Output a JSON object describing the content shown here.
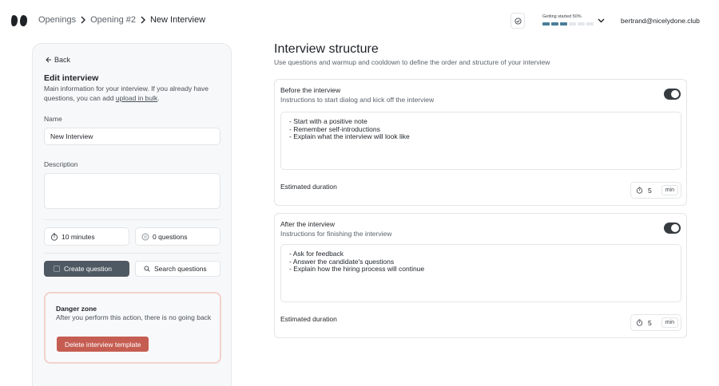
{
  "breadcrumb": {
    "items": [
      "Openings",
      "Opening #2"
    ],
    "current": "New Interview"
  },
  "header": {
    "progress_label": "Getting started 50%",
    "progress_percent": 50,
    "progress_segments_total": 6,
    "progress_segments_done": 3,
    "user_email": "bertrand@nicelydone.club"
  },
  "sidebar": {
    "back_label": "Back",
    "title": "Edit interview",
    "description_prefix": "Main information for your interview. If you already have questions, you can add",
    "upload_link": "upload in bulk",
    "description_suffix": ".",
    "name_label": "Name",
    "name_value": "New Interview",
    "description_label": "Description",
    "description_value": "",
    "duration_stat": "10 minutes",
    "questions_stat": "0 questions",
    "create_button": "Create question",
    "search_button": "Search questions",
    "danger": {
      "title": "Danger zone",
      "description": "After you perform this action, there is no going back",
      "button": "Delete interview template"
    }
  },
  "main": {
    "title": "Interview structure",
    "subtitle": "Use questions and warmup and cooldown to define the order and structure of your interview",
    "sections": [
      {
        "title": "Before the interview",
        "subtitle": "Instructions to start dialog and kick off the interview",
        "enabled": true,
        "lines": [
          "- Start with a positive note",
          "- Remember self-introductions",
          "- Explain what the interview will look like"
        ],
        "duration_label": "Estimated duration",
        "duration_value": "5",
        "duration_unit": "min"
      },
      {
        "title": "After the interview",
        "subtitle": "Instructions for finishing the interview",
        "enabled": true,
        "lines": [
          "- Ask for feedback",
          "- Answer the candidate's questions",
          "- Explain how the hiring process will continue"
        ],
        "duration_label": "Estimated duration",
        "duration_value": "5",
        "duration_unit": "min"
      }
    ]
  },
  "icons": {
    "logo": "logo-icon",
    "breadcrumb_separator": "chevron-right-icon",
    "status": "check-circle-icon",
    "dropdown": "chevron-down-icon",
    "back": "arrow-left-icon",
    "duration": "stopwatch-icon",
    "questions": "list-circle-icon",
    "create": "plus-square-icon",
    "search": "search-icon"
  },
  "colors": {
    "progress_on": "#4a7e9a",
    "primary_button": "#4f5963",
    "danger_button": "#c65d52",
    "danger_border": "#f3d2cc",
    "toggle_on": "#363b40"
  }
}
